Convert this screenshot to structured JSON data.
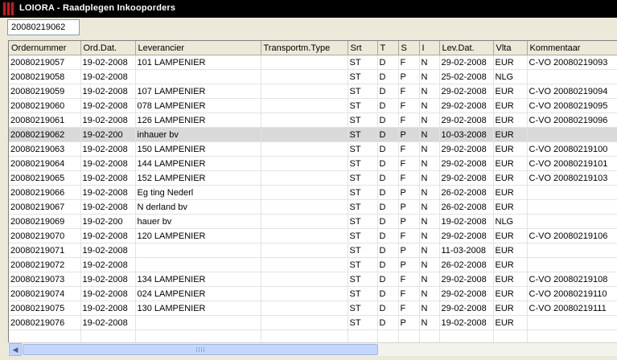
{
  "window": {
    "title": "LOIORA - Raadplegen Inkooporders"
  },
  "search": {
    "value": "20080219062"
  },
  "table": {
    "columns": [
      "Ordernummer",
      "Ord.Dat.",
      "Leverancier",
      "Transportm.Type",
      "Srt",
      "T",
      "S",
      "I",
      "Lev.Dat.",
      "Vlta",
      "Kommentaar"
    ],
    "rows": [
      [
        "20080219057",
        "19-02-2008",
        "101 LAMPENIER",
        "",
        "ST",
        "D",
        "F",
        "N",
        "29-02-2008",
        "EUR",
        "C-VO 20080219093"
      ],
      [
        "20080219058",
        "19-02-2008",
        "",
        "",
        "ST",
        "D",
        "P",
        "N",
        "25-02-2008",
        "NLG",
        ""
      ],
      [
        "20080219059",
        "19-02-2008",
        "107 LAMPENIER",
        "",
        "ST",
        "D",
        "F",
        "N",
        "29-02-2008",
        "EUR",
        "C-VO 20080219094"
      ],
      [
        "20080219060",
        "19-02-2008",
        "078 LAMPENIER",
        "",
        "ST",
        "D",
        "F",
        "N",
        "29-02-2008",
        "EUR",
        "C-VO 20080219095"
      ],
      [
        "20080219061",
        "19-02-2008",
        "126 LAMPENIER",
        "",
        "ST",
        "D",
        "F",
        "N",
        "29-02-2008",
        "EUR",
        "C-VO 20080219096"
      ],
      [
        "20080219062",
        "19-02-200",
        "inhauer bv",
        "",
        "ST",
        "D",
        "P",
        "N",
        "10-03-2008",
        "EUR",
        ""
      ],
      [
        "20080219063",
        "19-02-2008",
        "150 LAMPENIER",
        "",
        "ST",
        "D",
        "F",
        "N",
        "29-02-2008",
        "EUR",
        "C-VO 20080219100"
      ],
      [
        "20080219064",
        "19-02-2008",
        "144 LAMPENIER",
        "",
        "ST",
        "D",
        "F",
        "N",
        "29-02-2008",
        "EUR",
        "C-VO 20080219101"
      ],
      [
        "20080219065",
        "19-02-2008",
        "152 LAMPENIER",
        "",
        "ST",
        "D",
        "F",
        "N",
        "29-02-2008",
        "EUR",
        "C-VO 20080219103"
      ],
      [
        "20080219066",
        "19-02-2008",
        "Eg ting Nederl",
        "",
        "ST",
        "D",
        "P",
        "N",
        "26-02-2008",
        "EUR",
        ""
      ],
      [
        "20080219067",
        "19-02-2008",
        "N derland bv",
        "",
        "ST",
        "D",
        "P",
        "N",
        "26-02-2008",
        "EUR",
        ""
      ],
      [
        "20080219069",
        "19-02-200",
        "hauer bv",
        "",
        "ST",
        "D",
        "P",
        "N",
        "19-02-2008",
        "NLG",
        ""
      ],
      [
        "20080219070",
        "19-02-2008",
        "120 LAMPENIER",
        "",
        "ST",
        "D",
        "F",
        "N",
        "29-02-2008",
        "EUR",
        "C-VO 20080219106"
      ],
      [
        "20080219071",
        "19-02-2008",
        "",
        "",
        "ST",
        "D",
        "P",
        "N",
        "11-03-2008",
        "EUR",
        ""
      ],
      [
        "20080219072",
        "19-02-2008",
        "",
        "",
        "ST",
        "D",
        "P",
        "N",
        "26-02-2008",
        "EUR",
        ""
      ],
      [
        "20080219073",
        "19-02-2008",
        "134 LAMPENIER",
        "",
        "ST",
        "D",
        "F",
        "N",
        "29-02-2008",
        "EUR",
        "C-VO 20080219108"
      ],
      [
        "20080219074",
        "19-02-2008",
        "024 LAMPENIER",
        "",
        "ST",
        "D",
        "F",
        "N",
        "29-02-2008",
        "EUR",
        "C-VO 20080219110"
      ],
      [
        "20080219075",
        "19-02-2008",
        "130 LAMPENIER",
        "",
        "ST",
        "D",
        "F",
        "N",
        "29-02-2008",
        "EUR",
        "C-VO 20080219111"
      ],
      [
        "20080219076",
        "19-02-2008",
        "",
        "",
        "ST",
        "D",
        "P",
        "N",
        "19-02-2008",
        "EUR",
        ""
      ],
      [
        "",
        "",
        "",
        "",
        "",
        "",
        "",
        "",
        "",
        "",
        ""
      ]
    ],
    "selected_row": 5
  },
  "icons": {
    "app": "app-icon",
    "scroll_left": "arrow-left-icon",
    "scroll_right": "arrow-right-icon"
  }
}
